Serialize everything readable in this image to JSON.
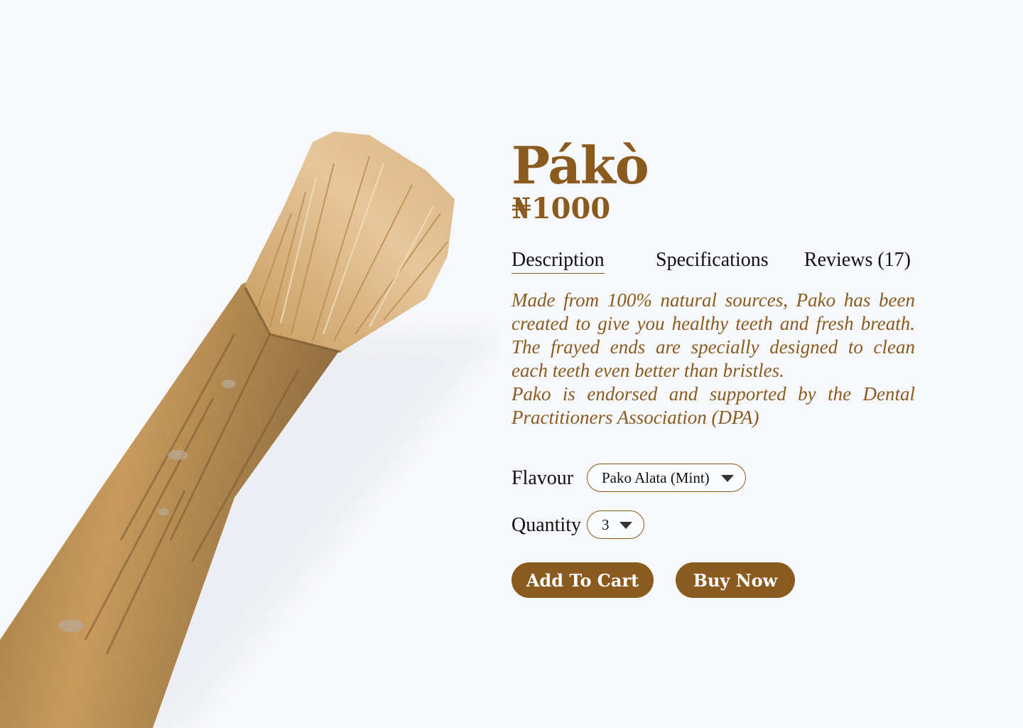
{
  "product": {
    "name": "Pákò",
    "price": "₦1000"
  },
  "tabs": [
    {
      "label": "Description",
      "active": true
    },
    {
      "label": "Specifications",
      "active": false
    },
    {
      "label": "Reviews (17)",
      "active": false
    }
  ],
  "description": {
    "paragraph1": "Made from 100% natural sources, Pako has been created to give you healthy teeth and fresh breath. The frayed ends are specially designed to clean each teeth even better than bristles.",
    "paragraph2": "Pako is endorsed and supported by the Dental Practitioners Association (DPA)"
  },
  "options": {
    "flavour_label": "Flavour",
    "flavour_value": "Pako Alata (Mint)",
    "quantity_label": "Quantity",
    "quantity_value": "3"
  },
  "actions": {
    "add_to_cart": "Add To Cart",
    "buy_now": "Buy Now"
  },
  "colors": {
    "accent": "#8a5a1f",
    "background": "#f7f8fb"
  },
  "icons": {
    "dropdown": "caret-down-icon"
  }
}
